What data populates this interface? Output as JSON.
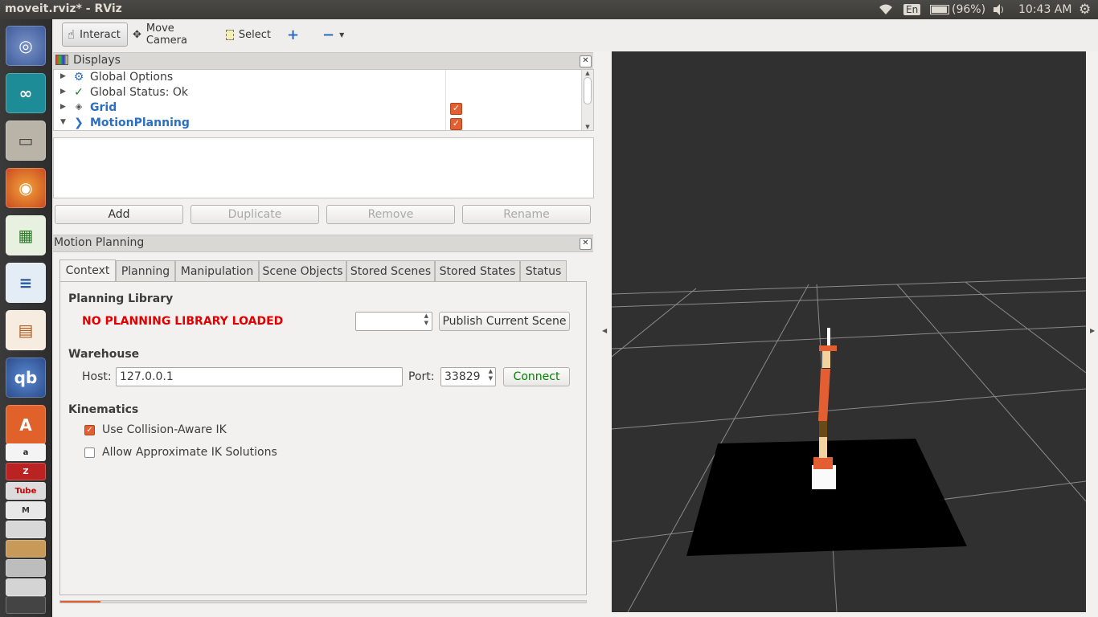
{
  "window": {
    "title": "moveit.rviz* - RViz"
  },
  "tray": {
    "keyboard": "En",
    "battery": "(96%)",
    "time": "10:43 AM"
  },
  "launcher": {
    "youtube_label": "Tube"
  },
  "toolbar": {
    "interact": "Interact",
    "move_camera": "Move Camera",
    "select": "Select"
  },
  "displays": {
    "title": "Displays",
    "items": [
      {
        "label": "Global Options"
      },
      {
        "label": "Global Status: Ok"
      },
      {
        "label": "Grid"
      },
      {
        "label": "MotionPlanning"
      }
    ],
    "buttons": {
      "add": "Add",
      "duplicate": "Duplicate",
      "remove": "Remove",
      "rename": "Rename"
    }
  },
  "motion_planning": {
    "title": "Motion Planning",
    "tabs": [
      "Context",
      "Planning",
      "Manipulation",
      "Scene Objects",
      "Stored Scenes",
      "Stored States",
      "Status"
    ],
    "planning_library": {
      "heading": "Planning Library",
      "status": "NO PLANNING LIBRARY LOADED",
      "publish_button": "Publish Current Scene"
    },
    "warehouse": {
      "heading": "Warehouse",
      "host_label": "Host:",
      "host_value": "127.0.0.1",
      "port_label": "Port:",
      "port_value": "33829",
      "connect_button": "Connect"
    },
    "kinematics": {
      "heading": "Kinematics",
      "collision_aware_ik": "Use Collision-Aware IK",
      "collision_aware_ik_checked": true,
      "approximate_ik": "Allow Approximate IK Solutions",
      "approximate_ik_checked": false
    }
  },
  "colors": {
    "accent_orange": "#e35f32",
    "error_red": "#e00000",
    "link_blue": "#2a6fc1",
    "connect_green": "#008000",
    "viewport_bg": "#303030"
  }
}
